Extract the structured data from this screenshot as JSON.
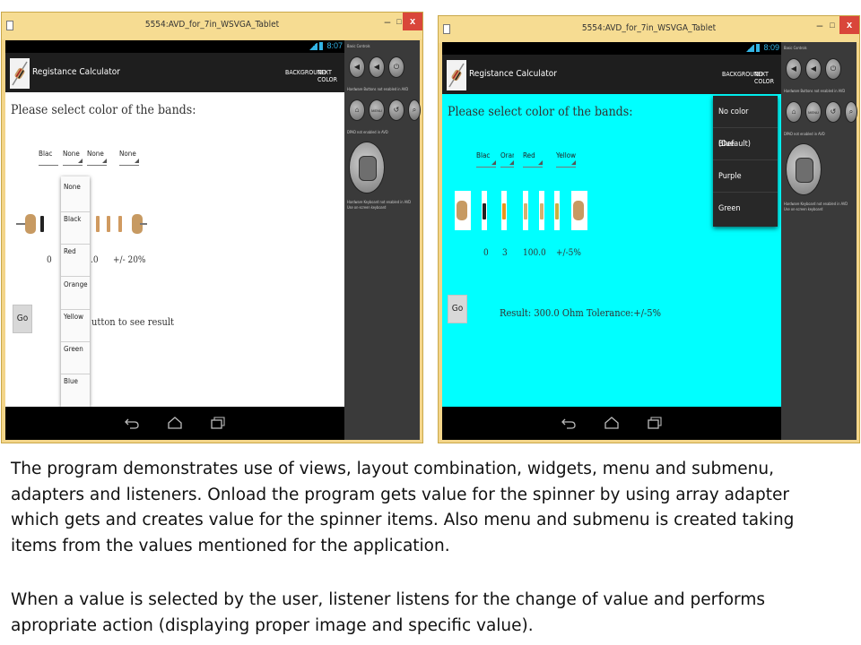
{
  "window_title": "5554:AVD_for_7in_WSVGA_Tablet",
  "window_controls": {
    "minimize": "–",
    "maximize": "□",
    "close": "x"
  },
  "app": {
    "title": "Registance Calculator",
    "menu": {
      "background": "BACKGROUND",
      "text_color": "TEXT COLOR"
    },
    "prompt": "Please select color of the bands:",
    "go_label": "Go",
    "nav_icons": [
      "back-icon",
      "home-icon",
      "recents-icon"
    ]
  },
  "screen_left": {
    "clock": "8:07",
    "background": "#ffffff",
    "spinners": [
      "Blac",
      "None",
      "None",
      "None"
    ],
    "dropdown_items": [
      "None",
      "Black",
      "Red",
      "Orange",
      "Yellow",
      "Green",
      "Blue"
    ],
    "values": {
      "v1": "0",
      "v3": ".0",
      "tolerance": "+/- 20%"
    },
    "result": "utton to see result"
  },
  "screen_right": {
    "clock": "8:09",
    "background": "#00ffff",
    "spinners": [
      "Blac",
      "Oran",
      "Red",
      "Yellow"
    ],
    "overflow_items": [
      "No color (Default)",
      "Blue",
      "Purple",
      "Green"
    ],
    "values": {
      "v1": "0",
      "v2": "3",
      "v3": "100.0",
      "tolerance": "+/-5%"
    },
    "result": "Result: 300.0 Ohm Tolerance:+/-5%"
  },
  "controls": {
    "basic_controls": "Basic Controls",
    "hardware_buttons": "Hardware Buttons not enabled in AVD",
    "dpad": "DPAD not enabled in AVD",
    "keyboard_line1": "Hardware Keyboard not enabled in AVD",
    "keyboard_line2": "Use on-screen keyboard",
    "menu_button": "MENU"
  },
  "caption": {
    "paragraph1_lines": [
      "The program demonstrates use of views, layout combination, widgets, menu and submenu,",
      "adapters and listeners.  Onload the program gets value for the spinner by using array adapter",
      "which gets and creates value for the spinner items.  Also menu and submenu is created taking",
      "items from the values mentioned for the application."
    ],
    "paragraph2_lines": [
      "When a value is selected by the user, listener listens for the change of value and performs",
      "apropriate action (displaying proper image and specific value)."
    ]
  },
  "colors": {
    "window_frame": "#f3d58a",
    "close_button": "#d9463a",
    "action_bar": "#1e1e1e",
    "accent_blue": "#33b5e5",
    "cyan_background": "#00ffff",
    "resistor_body": "#c79a62"
  }
}
